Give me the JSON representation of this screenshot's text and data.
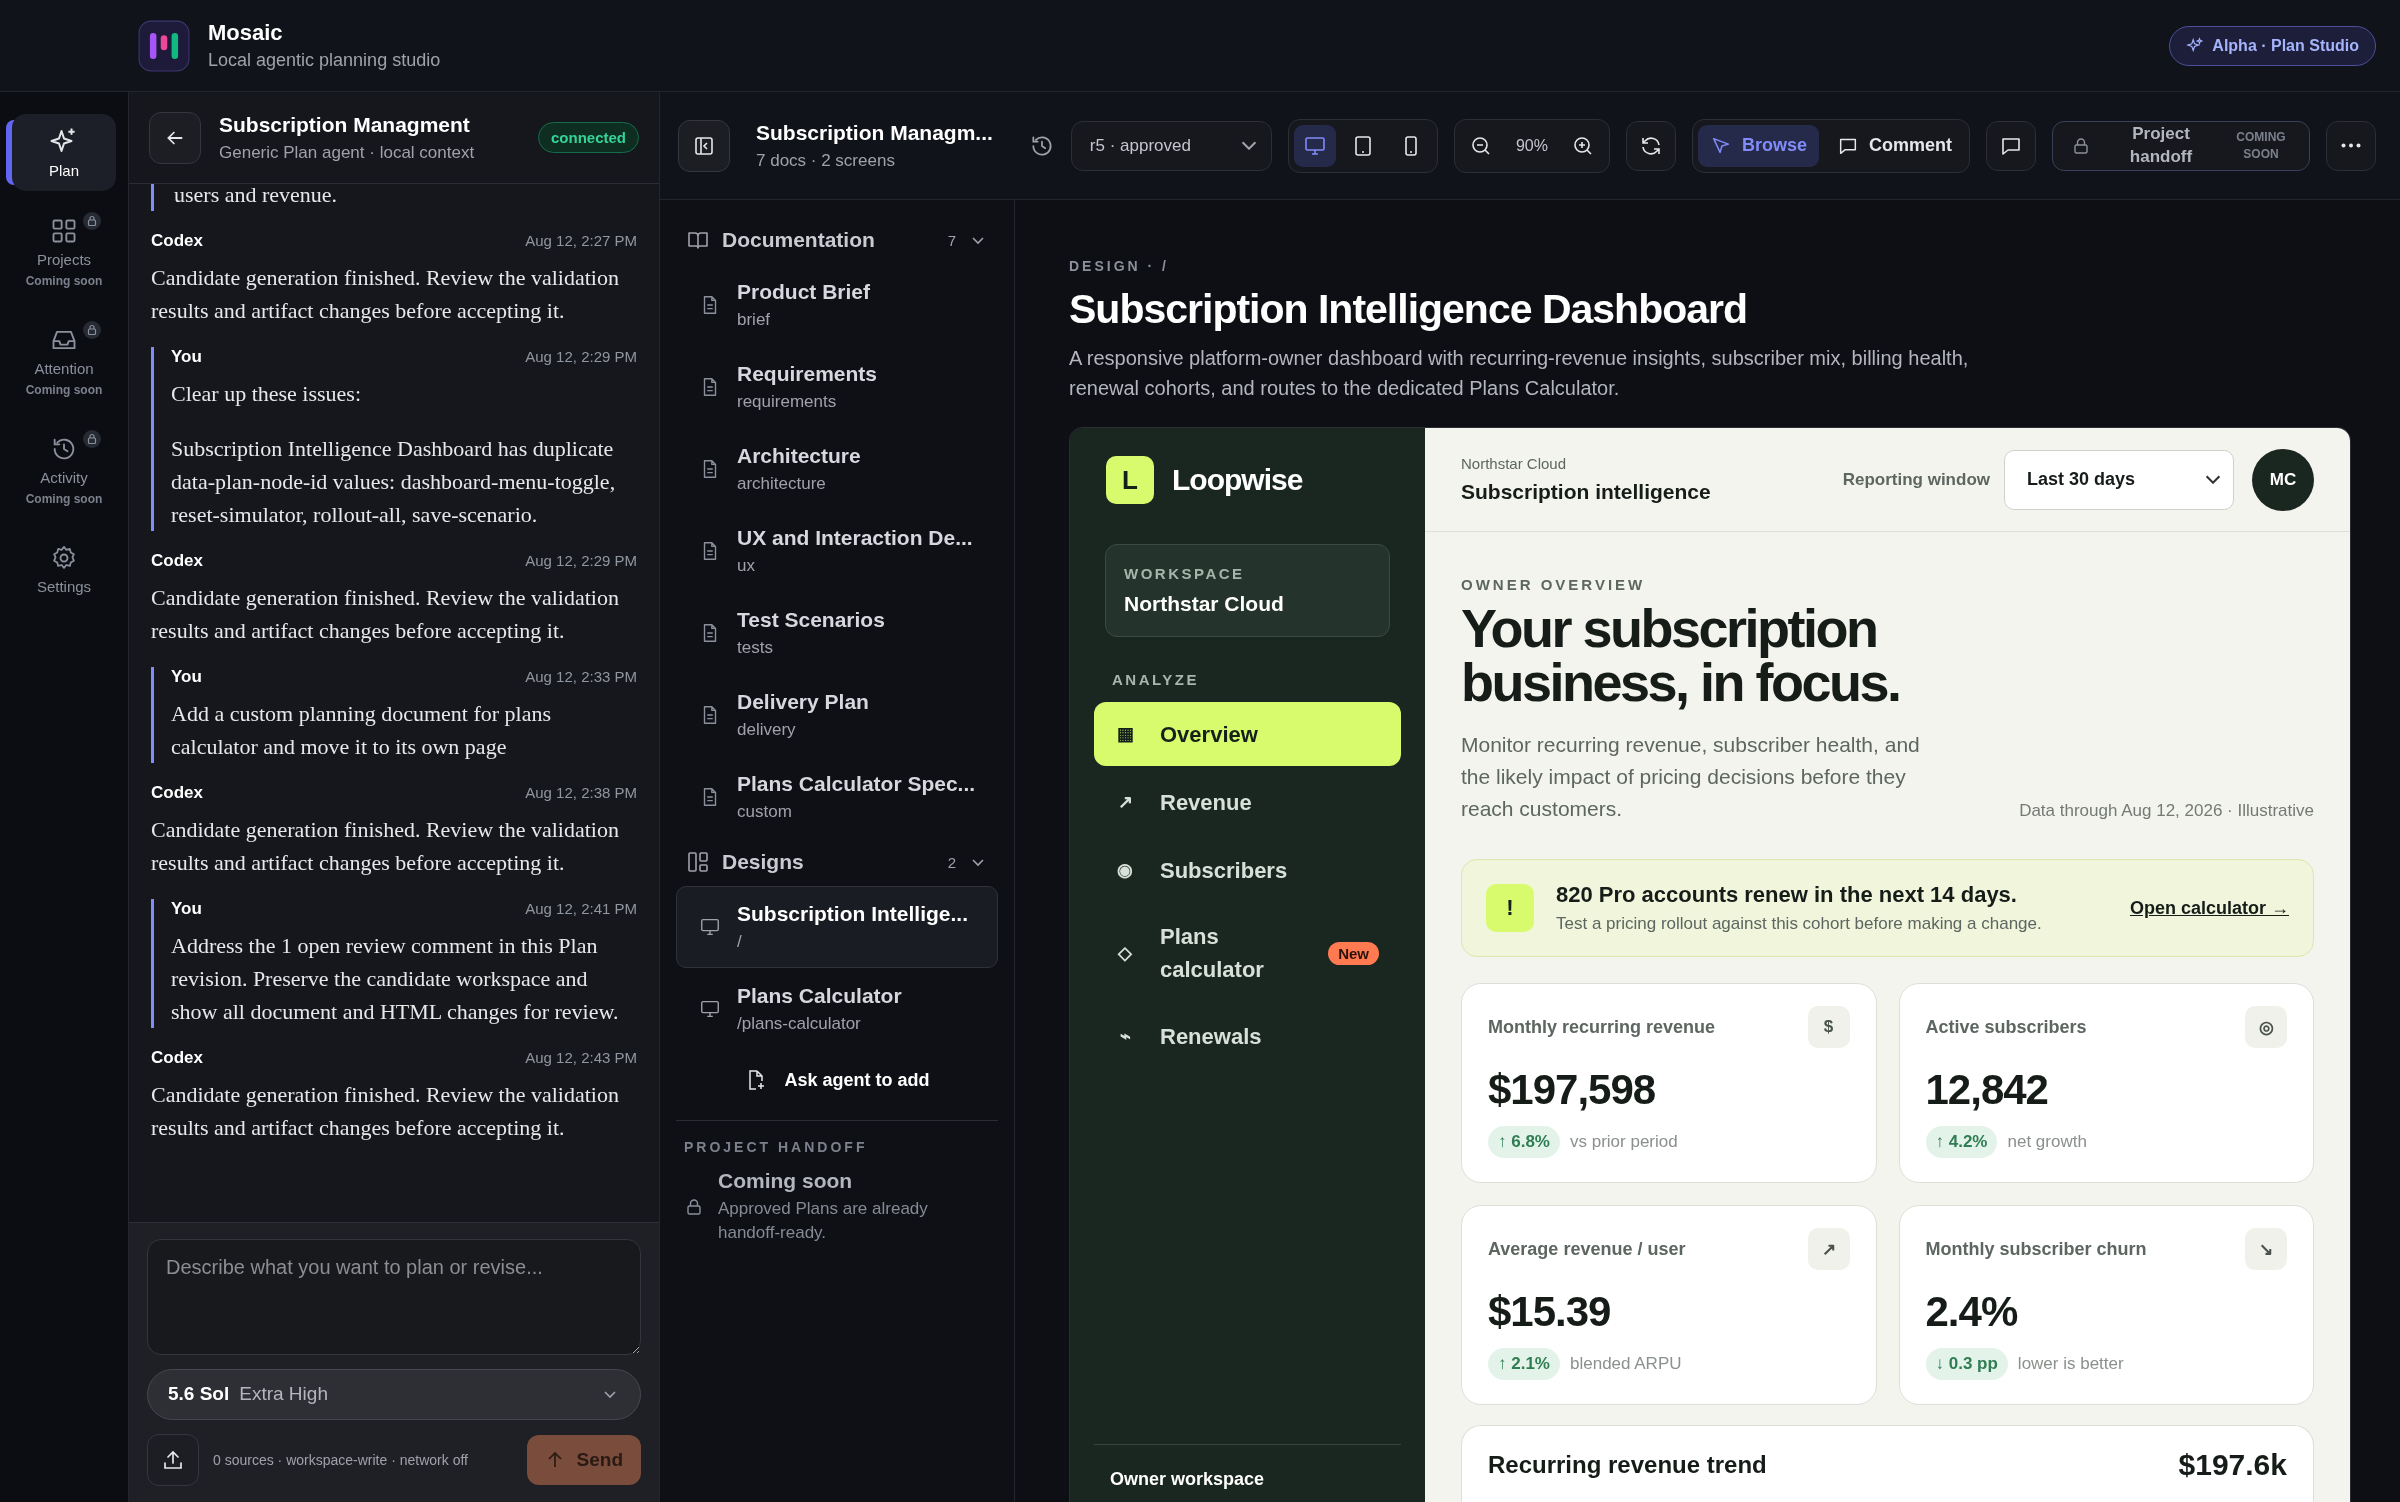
{
  "app": {
    "name": "Mosaic",
    "subtitle": "Local agentic planning studio",
    "badge": "Alpha · Plan Studio"
  },
  "rail": [
    {
      "label": "Plan",
      "kind": "sparkle",
      "selected": true,
      "locked": false
    },
    {
      "label": "Projects",
      "note": "Coming soon",
      "kind": "grid",
      "selected": false,
      "locked": true
    },
    {
      "label": "Attention",
      "note": "Coming soon",
      "kind": "inbox",
      "selected": false,
      "locked": true
    },
    {
      "label": "Activity",
      "note": "Coming soon",
      "kind": "history",
      "selected": false,
      "locked": true
    },
    {
      "label": "Settings",
      "kind": "gear",
      "selected": false,
      "locked": false
    }
  ],
  "chat": {
    "title": "Subscription Managment",
    "subtitle": "Generic Plan agent · local context",
    "status": "connected",
    "lead": "users and revenue.",
    "messages": [
      {
        "author": "Codex",
        "kind": "agent",
        "time": "Aug 12, 2:27 PM",
        "paragraphs": [
          "Candidate generation finished. Review the validation results and artifact changes before accepting it."
        ]
      },
      {
        "author": "You",
        "kind": "user",
        "time": "Aug 12, 2:29 PM",
        "paragraphs": [
          "Clear up these issues:",
          "Subscription Intelligence Dashboard has duplicate data-plan-node-id values: dashboard-menu-toggle, reset-simulator, rollout-all, save-scenario."
        ]
      },
      {
        "author": "Codex",
        "kind": "agent",
        "time": "Aug 12, 2:29 PM",
        "paragraphs": [
          "Candidate generation finished. Review the validation results and artifact changes before accepting it."
        ]
      },
      {
        "author": "You",
        "kind": "user",
        "time": "Aug 12, 2:33 PM",
        "paragraphs": [
          "Add a custom planning document for plans calculator and move it to its own page"
        ]
      },
      {
        "author": "Codex",
        "kind": "agent",
        "time": "Aug 12, 2:38 PM",
        "paragraphs": [
          "Candidate generation finished. Review the validation results and artifact changes before accepting it."
        ]
      },
      {
        "author": "You",
        "kind": "user",
        "time": "Aug 12, 2:41 PM",
        "paragraphs": [
          "Address the 1 open review comment in this Plan revision. Preserve the candidate workspace and show all document and HTML changes for review."
        ]
      },
      {
        "author": "Codex",
        "kind": "agent",
        "time": "Aug 12, 2:43 PM",
        "paragraphs": [
          "Candidate generation finished. Review the validation results and artifact changes before accepting it."
        ]
      }
    ],
    "composer": {
      "placeholder": "Describe what you want to plan or revise...",
      "model": "5.6 Sol",
      "effort": "Extra High",
      "meta": "0 sources · workspace-write · network off",
      "send": "Send"
    }
  },
  "plan": {
    "title": "Subscription Managm...",
    "meta": "7 docs · 2 screens",
    "revision": "r5 · approved",
    "devices": [
      {
        "kind": "desktop",
        "selected": true
      },
      {
        "kind": "tablet",
        "selected": false
      },
      {
        "kind": "phone",
        "selected": false
      }
    ],
    "zoom": "90%",
    "modes": [
      {
        "label": "Browse",
        "kind": "pointer",
        "selected": true
      },
      {
        "label": "Comment",
        "kind": "comment",
        "selected": false
      }
    ],
    "handoff": {
      "label": "Project handoff",
      "note": "COMING SOON"
    }
  },
  "sections": [
    {
      "title": "Documentation",
      "kind": "docs",
      "count": "7",
      "expanded": true,
      "items": [
        {
          "title": "Product Brief",
          "subtitle": "brief",
          "selected": false
        },
        {
          "title": "Requirements",
          "subtitle": "requirements",
          "selected": false
        },
        {
          "title": "Architecture",
          "subtitle": "architecture",
          "selected": false
        },
        {
          "title": "UX and Interaction De...",
          "subtitle": "ux",
          "selected": false
        },
        {
          "title": "Test Scenarios",
          "subtitle": "tests",
          "selected": false
        },
        {
          "title": "Delivery Plan",
          "subtitle": "delivery",
          "selected": false
        },
        {
          "title": "Plans Calculator Spec...",
          "subtitle": "custom",
          "selected": false
        }
      ]
    },
    {
      "title": "Designs",
      "kind": "screens",
      "count": "2",
      "expanded": true,
      "items": [
        {
          "title": "Subscription Intellige...",
          "subtitle": "/",
          "selected": true
        },
        {
          "title": "Plans Calculator",
          "subtitle": "/plans-calculator",
          "selected": false
        }
      ]
    }
  ],
  "ask": "Ask agent to add",
  "handoff_section": {
    "heading": "PROJECT HANDOFF",
    "title": "Coming soon",
    "text": "Approved Plans are already handoff-ready."
  },
  "preview": {
    "breadcrumb": "DESIGN · /",
    "title": "Subscription Intelligence Dashboard",
    "description": "A responsive platform-owner dashboard with recurring-revenue insights, subscriber mix, billing health, renewal cohorts, and routes to the dedicated Plans Calculator."
  },
  "dashboard": {
    "brand_mark": "L",
    "brand": "Loopwise",
    "workspace_label": "WORKSPACE",
    "workspace": "Northstar Cloud",
    "nav_heading": "ANALYZE",
    "nav": [
      {
        "icon": "▦",
        "label": "Overview",
        "selected": true
      },
      {
        "icon": "↗",
        "label": "Revenue",
        "selected": false
      },
      {
        "icon": "◉",
        "label": "Subscribers",
        "selected": false
      },
      {
        "icon": "◇",
        "label": "Plans calculator",
        "selected": false,
        "badge": "New"
      },
      {
        "icon": "⌁",
        "label": "Renewals",
        "selected": false
      }
    ],
    "footer": "Owner workspace",
    "org": "Northstar Cloud",
    "page": "Subscription intelligence",
    "window_label": "Reporting window",
    "window_value": "Last 30 days",
    "avatar": "MC",
    "eyebrow": "OWNER OVERVIEW",
    "headline": "Your subscription business, in focus.",
    "intro": "Monitor recurring revenue, subscriber health, and the likely impact of pricing decisions before they reach customers.",
    "data_note": "Data through Aug 12, 2026 · Illustrative",
    "alert": {
      "mark": "!",
      "title": "820 Pro accounts renew in the next 14 days.",
      "text": "Test a pricing rollout against this cohort before making a change.",
      "link": "Open calculator →"
    },
    "metrics": [
      {
        "label": "Monthly recurring revenue",
        "icon": "$",
        "value": "$197,598",
        "delta": "↑ 6.8%",
        "note": "vs prior period"
      },
      {
        "label": "Active subscribers",
        "icon": "◎",
        "value": "12,842",
        "delta": "↑ 4.2%",
        "note": "net growth"
      },
      {
        "label": "Average revenue / user",
        "icon": "↗",
        "value": "$15.39",
        "delta": "↑ 2.1%",
        "note": "blended ARPU"
      },
      {
        "label": "Monthly subscriber churn",
        "icon": "↘",
        "value": "2.4%",
        "delta": "↓ 0.3 pp",
        "note": "lower is better"
      }
    ],
    "trend": {
      "title": "Recurring revenue trend",
      "value": "$197.6k"
    }
  }
}
